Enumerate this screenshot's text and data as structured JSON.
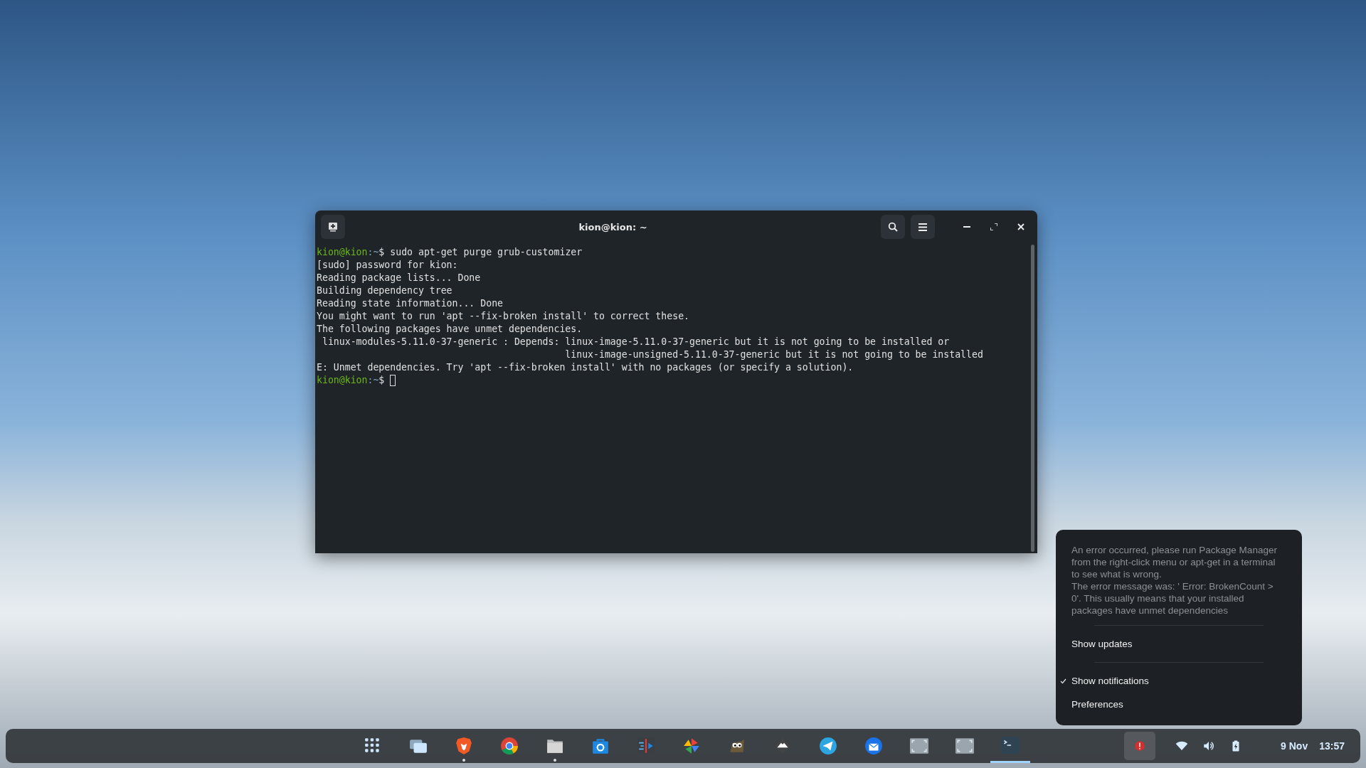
{
  "terminal": {
    "title": "kion@kion: ~",
    "lines": [
      {
        "kind": "prompt",
        "user": "kion@kion",
        "path": ":~",
        "symbol": "$",
        "command": " sudo apt-get purge grub-customizer",
        "cursor": false
      },
      {
        "kind": "output",
        "text": "[sudo] password for kion:"
      },
      {
        "kind": "output",
        "text": "Reading package lists... Done"
      },
      {
        "kind": "output",
        "text": "Building dependency tree"
      },
      {
        "kind": "output",
        "text": "Reading state information... Done"
      },
      {
        "kind": "output",
        "text": "You might want to run 'apt --fix-broken install' to correct these."
      },
      {
        "kind": "output",
        "text": "The following packages have unmet dependencies."
      },
      {
        "kind": "output",
        "text": " linux-modules-5.11.0-37-generic : Depends: linux-image-5.11.0-37-generic but it is not going to be installed or"
      },
      {
        "kind": "output",
        "text": "                                            linux-image-unsigned-5.11.0-37-generic but it is not going to be installed"
      },
      {
        "kind": "output",
        "text": "E: Unmet dependencies. Try 'apt --fix-broken install' with no packages (or specify a solution)."
      },
      {
        "kind": "prompt",
        "user": "kion@kion",
        "path": ":~",
        "symbol": "$",
        "cursor": true
      }
    ]
  },
  "menu": {
    "message": [
      "An error occurred, please run Package Manager from the right-click menu or apt-get in a terminal to see what is wrong.",
      "The error message was: ' Error: BrokenCount > 0'. This usually means that your installed packages have unmet dependencies"
    ],
    "sections": [
      [
        {
          "label": "Show updates",
          "checked": false
        }
      ],
      [
        {
          "label": "Show notifications",
          "checked": true
        },
        {
          "label": "Preferences",
          "checked": false
        }
      ]
    ]
  },
  "taskbar": {
    "apps": [
      {
        "kind": "grid",
        "running": false,
        "selected": false
      },
      {
        "kind": "windows",
        "running": false,
        "selected": false
      },
      {
        "kind": "lion",
        "running": true,
        "selected": false
      },
      {
        "kind": "ring",
        "running": false,
        "selected": false
      },
      {
        "kind": "folder",
        "running": true,
        "selected": false
      },
      {
        "kind": "bag",
        "running": false,
        "selected": false
      },
      {
        "kind": "editor",
        "running": false,
        "selected": false
      },
      {
        "kind": "pinwheel",
        "running": false,
        "selected": false
      },
      {
        "kind": "owl",
        "running": false,
        "selected": false
      },
      {
        "kind": "mountain",
        "running": false,
        "selected": false
      },
      {
        "kind": "plane",
        "running": false,
        "selected": false
      },
      {
        "kind": "mail",
        "running": false,
        "selected": false
      },
      {
        "kind": "thumb",
        "running": false,
        "selected": false
      },
      {
        "kind": "thumb",
        "running": false,
        "selected": false
      },
      {
        "kind": "terminal",
        "selected": true
      }
    ],
    "tray": [
      {
        "kind": "error",
        "selected": true
      },
      {
        "kind": "wifi",
        "selected": false
      },
      {
        "kind": "volume",
        "selected": false
      },
      {
        "kind": "battery",
        "selected": false
      }
    ],
    "date": "9 Nov",
    "time": "13:57"
  }
}
